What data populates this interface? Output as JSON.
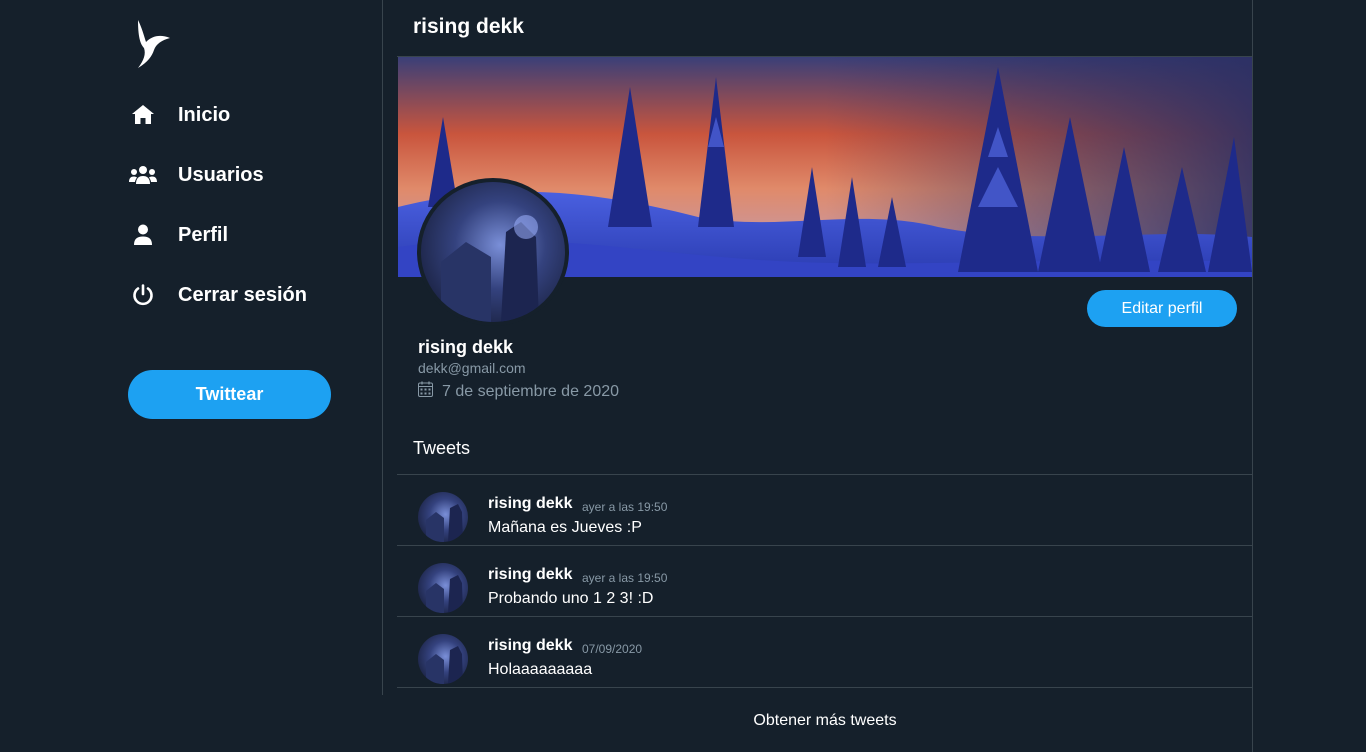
{
  "sidebar": {
    "logo_icon": "bird-logo-icon",
    "items": [
      {
        "label": "Inicio",
        "icon": "home-icon"
      },
      {
        "label": "Usuarios",
        "icon": "users-icon"
      },
      {
        "label": "Perfil",
        "icon": "user-icon"
      },
      {
        "label": "Cerrar sesión",
        "icon": "power-icon"
      }
    ],
    "tweet_button": "Twittear"
  },
  "header": {
    "title": "rising dekk"
  },
  "profile": {
    "name": "rising dekk",
    "email": "dekk@gmail.com",
    "joined": "7 de septiembre de 2020",
    "edit_button": "Editar perfil"
  },
  "tweets": {
    "heading": "Tweets",
    "items": [
      {
        "name": "rising dekk",
        "time": "ayer a las 19:50",
        "text": "Mañana es Jueves :P"
      },
      {
        "name": "rising dekk",
        "time": "ayer a las 19:50",
        "text": "Probando uno 1 2 3! :D"
      },
      {
        "name": "rising dekk",
        "time": "07/09/2020",
        "text": "Holaaaaaaaaa"
      }
    ],
    "more": "Obtener más tweets"
  },
  "colors": {
    "background": "#15202b",
    "accent": "#1da1f2",
    "muted_text": "#8899a6",
    "border": "#38444d"
  }
}
